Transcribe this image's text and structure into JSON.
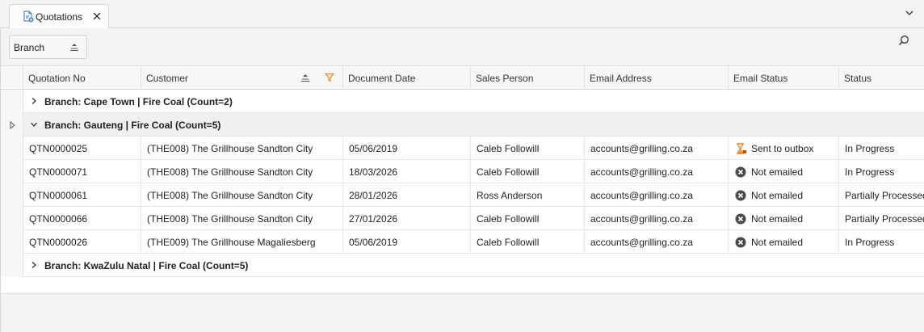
{
  "tab": {
    "label": "Quotations",
    "icon": "document-add-icon",
    "close_icon": "close-icon"
  },
  "group_panel": {
    "chip_label": "Branch",
    "chip_sort_icon": "sort-ascending-icon",
    "search_icon": "search-icon"
  },
  "columns": [
    {
      "label": "Quotation No"
    },
    {
      "label": "Customer"
    },
    {
      "label": "Document Date"
    },
    {
      "label": "Sales Person"
    },
    {
      "label": "Email Address"
    },
    {
      "label": "Email Status"
    },
    {
      "label": "Status"
    }
  ],
  "groups": [
    {
      "label": "Branch: Cape Town | Fire Coal (Count=2)",
      "expanded": false
    },
    {
      "label": "Branch: Gauteng | Fire Coal (Count=5)",
      "expanded": true
    },
    {
      "label": "Branch: KwaZulu Natal | Fire Coal (Count=5)",
      "expanded": false
    }
  ],
  "rows": [
    {
      "quotation_no": "QTN0000025",
      "customer": "(THE008) The Grillhouse Sandton City",
      "document_date": "05/06/2019",
      "sales_person": "Caleb Followill",
      "email": "accounts@grilling.co.za",
      "email_status": "Sent to outbox",
      "email_status_icon": "hourglass-icon",
      "status": "In Progress"
    },
    {
      "quotation_no": "QTN0000071",
      "customer": "(THE008) The Grillhouse Sandton City",
      "document_date": "18/03/2026",
      "sales_person": "Caleb Followill",
      "email": "accounts@grilling.co.za",
      "email_status": "Not emailed",
      "email_status_icon": "not-emailed-icon",
      "status": "In Progress"
    },
    {
      "quotation_no": "QTN0000061",
      "customer": "(THE008) The Grillhouse Sandton City",
      "document_date": "28/01/2026",
      "sales_person": "Ross Anderson",
      "email": "accounts@grilling.co.za",
      "email_status": "Not emailed",
      "email_status_icon": "not-emailed-icon",
      "status": "Partially Processed"
    },
    {
      "quotation_no": "QTN0000066",
      "customer": "(THE008) The Grillhouse Sandton City",
      "document_date": "27/01/2026",
      "sales_person": "Caleb Followill",
      "email": "accounts@grilling.co.za",
      "email_status": "Not emailed",
      "email_status_icon": "not-emailed-icon",
      "status": "Partially Processed"
    },
    {
      "quotation_no": "QTN0000026",
      "customer": "(THE009) The Grillhouse Magaliesberg",
      "document_date": "05/06/2019",
      "sales_person": "Caleb Followill",
      "email": "accounts@grilling.co.za",
      "email_status": "Not emailed",
      "email_status_icon": "not-emailed-icon",
      "status": "In Progress"
    }
  ],
  "colors": {
    "filter_icon": "#e8891c",
    "hourglass": "#e8891c",
    "not_emailed": "#4a4a4a",
    "group_expanded_bg": "#f0f0f0"
  }
}
